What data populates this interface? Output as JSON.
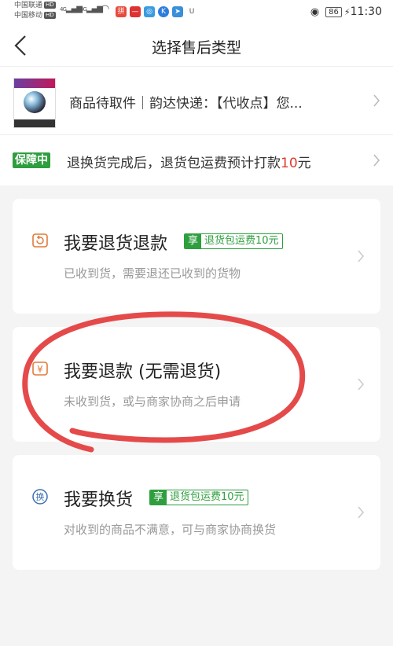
{
  "status_bar": {
    "carrier1": "中国联通",
    "carrier2": "中国移动",
    "hd_label": "HD",
    "net1": "4G",
    "net2": "4G",
    "battery": "86",
    "time": "11:30"
  },
  "nav": {
    "title": "选择售后类型"
  },
  "product": {
    "description": "商品待取件｜韵达快递：【代收点】您..."
  },
  "guarantee": {
    "badge": "保障中",
    "text_prefix": "退换货完成后，退货包运费预计打款",
    "amount": "10",
    "unit": "元"
  },
  "options": [
    {
      "title": "我要退货退款",
      "tag_prefix": "享",
      "tag_text": "退货包运费10元",
      "subtitle": "已收到货，需要退还已收到的货物",
      "icon": "return-box-icon"
    },
    {
      "title": "我要退款 (无需退货)",
      "subtitle": "未收到货，或与商家协商之后申请",
      "icon": "yuan-refund-icon"
    },
    {
      "title": "我要换货",
      "tag_prefix": "享",
      "tag_text": "退货包运费10元",
      "subtitle": "对收到的商品不满意，可与商家协商换货",
      "icon": "exchange-icon",
      "icon_char": "换"
    }
  ],
  "colors": {
    "accent_green": "#2e9e3f",
    "amount_red": "#e03a2f",
    "annotation_red": "#e33b3b",
    "icon_orange": "#e07b3c",
    "icon_blue": "#3a6fb0"
  }
}
